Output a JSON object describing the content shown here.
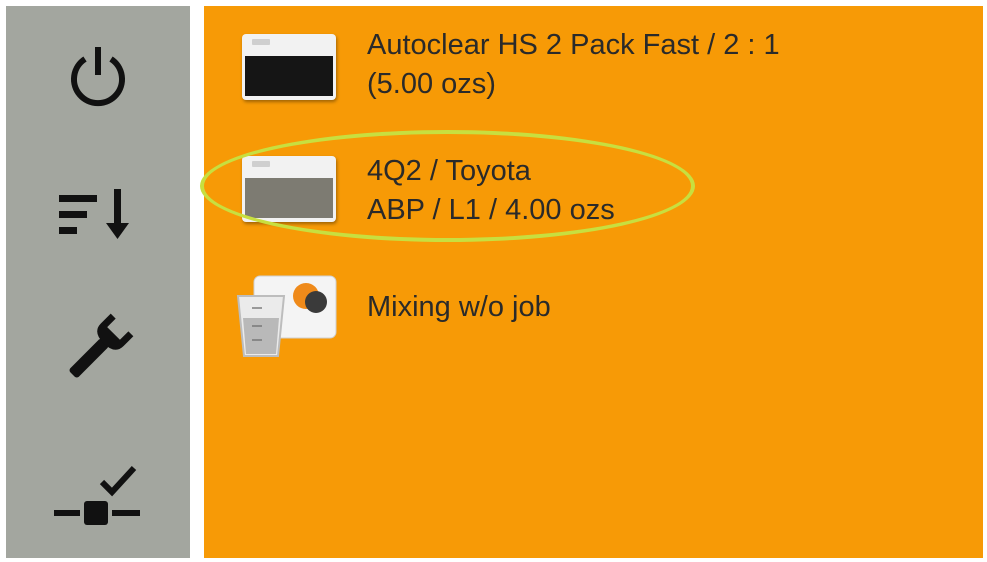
{
  "sidebar": {
    "buttons": [
      {
        "icon": "power-icon"
      },
      {
        "icon": "sort-descending-icon"
      },
      {
        "icon": "wrench-icon"
      },
      {
        "icon": "connection-check-icon"
      }
    ]
  },
  "jobs": [
    {
      "icon": "paint-card-icon",
      "swatch_color": "#151515",
      "line1": "Autoclear HS  2 Pack Fast / 2 : 1",
      "line2": "(5.00 ozs)"
    },
    {
      "icon": "paint-card-icon",
      "swatch_color": "#7d7b72",
      "line1": "4Q2 / Toyota",
      "line2": "ABP / L1 / 4.00 ozs",
      "highlighted": true
    },
    {
      "icon": "mixing-cup-icon",
      "line1": "Mixing w/o job"
    }
  ],
  "colors": {
    "sidebar_bg": "#a3a69f",
    "main_bg": "#f79a06",
    "highlight": "#c8df3f"
  }
}
